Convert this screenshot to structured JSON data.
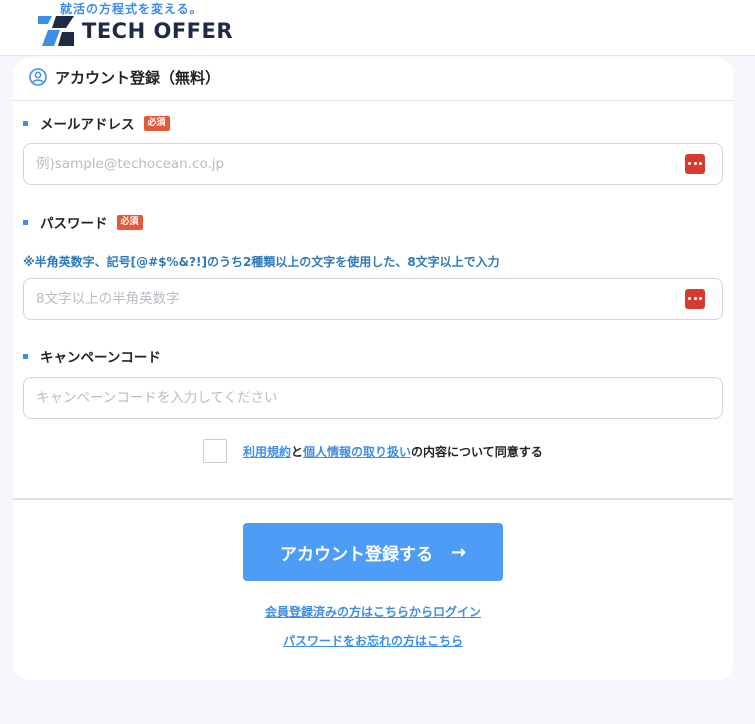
{
  "header": {
    "tagline": "就活の方程式を変える。",
    "logo_text": "TECH OFFER"
  },
  "form": {
    "title": "アカウント登録（無料）",
    "required_badge": "必須",
    "email": {
      "label": "メールアドレス",
      "placeholder": "例)sample@techocean.co.jp",
      "value": ""
    },
    "password": {
      "label": "パスワード",
      "hint": "※半角英数字、記号[@#$%&?!]のうち2種類以上の文字を使用した、8文字以上で入力",
      "placeholder": "8文字以上の半角英数字",
      "value": ""
    },
    "campaign": {
      "label": "キャンペーンコード",
      "placeholder": "キャンペーンコードを入力してください",
      "value": ""
    },
    "agreement": {
      "checked": false,
      "terms_link": "利用規約",
      "conj": "と",
      "privacy_link": "個人情報の取り扱い",
      "suffix": "の内容について同意する"
    },
    "submit_label": "アカウント登録する",
    "submit_arrow": "→",
    "login_link": "会員登録済みの方はこちらからログイン",
    "forgot_link": "パスワードをお忘れの方はこちら"
  },
  "colors": {
    "accent": "#4d9cf5",
    "required": "#e35a3b",
    "hint": "#2e7ab8",
    "password_manager": "#d63b2f"
  },
  "icons": {
    "logo": "tech-offer-logo-icon",
    "account": "user-circle-icon",
    "password_manager": "password-manager-icon"
  }
}
